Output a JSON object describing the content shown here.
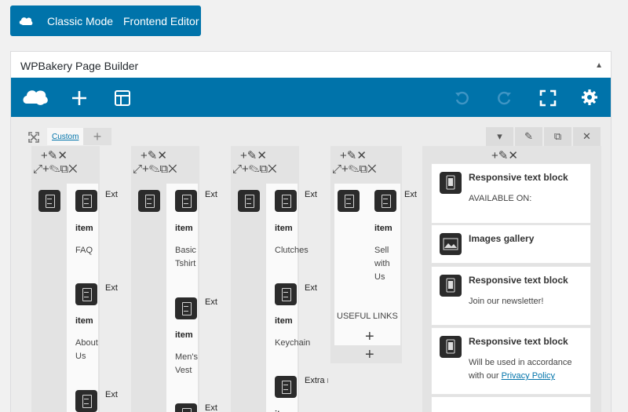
{
  "mode_bar": {
    "classic_label": "Classic Mode",
    "frontend_label": "Frontend Editor"
  },
  "editor": {
    "title": "WPBakery Page Builder",
    "collapse_glyph": "▲"
  },
  "toolbar": {
    "icons": [
      "wpbakery-logo-icon",
      "add-element-icon",
      "templates-icon",
      "undo-icon",
      "redo-icon",
      "fullscreen-icon",
      "settings-icon"
    ]
  },
  "row": {
    "tab_label": "Custom",
    "add_glyph": "+"
  },
  "glyphs": {
    "col_top": "+✎✕",
    "col_tools": "⤢+✎⧉✕",
    "plus": "+"
  },
  "columns": [
    {
      "items": [
        {
          "menu": "Extra menu list",
          "item": "item",
          "sub": [
            "FAQ"
          ]
        },
        {
          "menu": "Extra menu list",
          "item": "item",
          "sub": [
            "About",
            "Us"
          ]
        },
        {
          "menu": "Extra menu list"
        }
      ]
    },
    {
      "items": [
        {
          "menu": "Extra menu list",
          "item": "item",
          "sub": [
            "Basic",
            "Tshirt"
          ]
        },
        {
          "menu": "Extra menu list",
          "item": "item",
          "sub": [
            "Men's",
            "Vest"
          ]
        },
        {
          "menu": "Extra menu list"
        }
      ]
    },
    {
      "items": [
        {
          "menu": "Extra menu list",
          "item": "item",
          "sub": [
            "Clutches"
          ]
        },
        {
          "menu": "Extra menu list",
          "item": "item",
          "sub": [
            "Keychain"
          ]
        },
        {
          "menu": "Extra menu list",
          "item": "item"
        }
      ]
    },
    {
      "items": [
        {
          "menu": "Extra menu list",
          "item": "item",
          "sub": [
            "Sell",
            "with",
            "Us"
          ]
        }
      ],
      "footer_text": "USEFUL LINKS"
    }
  ],
  "right_cards": [
    {
      "title": "Responsive text block",
      "text": "AVAILABLE ON:"
    },
    {
      "title": "Images gallery"
    },
    {
      "title": "Responsive text block",
      "text": "Join our newsletter!"
    },
    {
      "title": "Responsive text block",
      "text": "Will be used in accordance with our",
      "link": "Privacy Policy"
    }
  ]
}
